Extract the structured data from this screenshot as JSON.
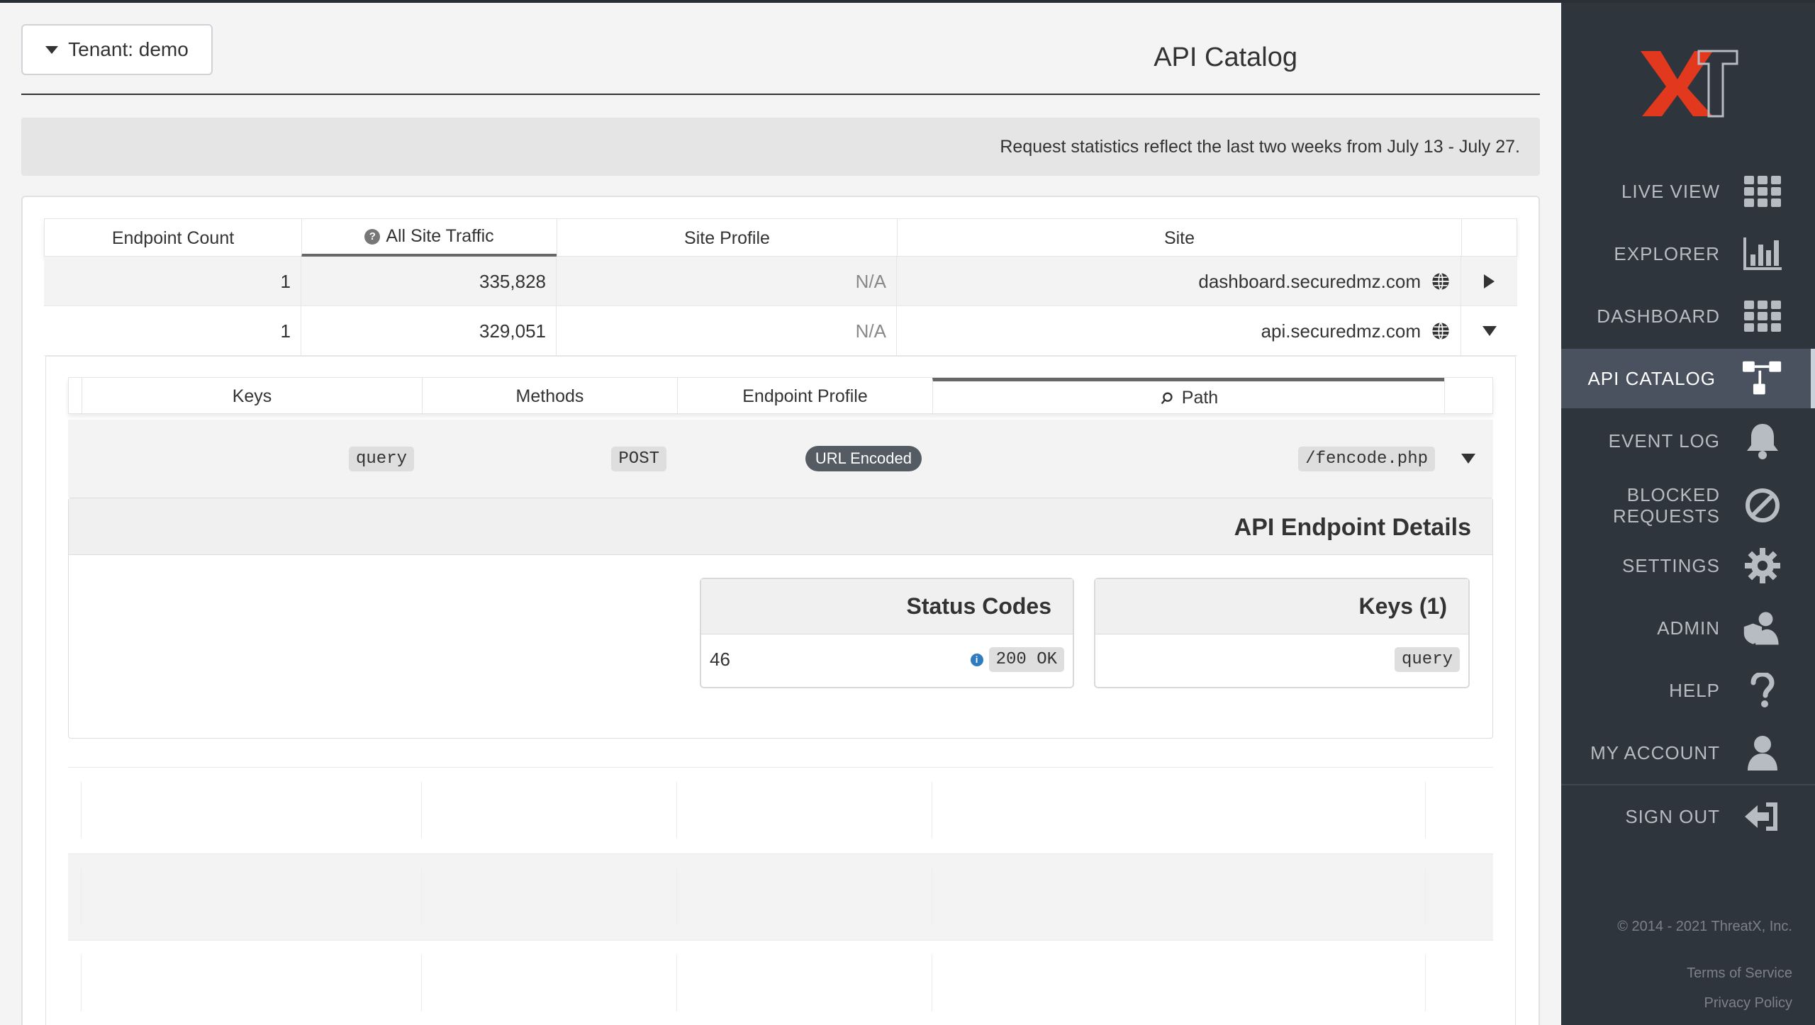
{
  "app": {
    "tenant_button": "Tenant: demo",
    "page_title": "API Catalog",
    "notice": "Request statistics reflect the last two weeks from July 13 - July 27."
  },
  "sidebar": {
    "items": [
      {
        "label": "LIVE VIEW",
        "icon": "grid-icon"
      },
      {
        "label": "EXPLORER",
        "icon": "bar-chart-icon"
      },
      {
        "label": "DASHBOARD",
        "icon": "dashboard-grid-icon"
      },
      {
        "label": "API CATALOG",
        "icon": "api-catalog-icon",
        "active": true
      },
      {
        "label": "EVENT LOG",
        "icon": "bell-icon"
      },
      {
        "label": "BLOCKED\nREQUESTS",
        "icon": "blocked-icon"
      },
      {
        "label": "SETTINGS",
        "icon": "gear-icon"
      },
      {
        "label": "ADMIN",
        "icon": "admin-shield-icon"
      },
      {
        "label": "HELP",
        "icon": "help-question-icon"
      },
      {
        "label": "MY ACCOUNT",
        "icon": "user-icon"
      },
      {
        "label": "SIGN OUT",
        "icon": "sign-out-icon"
      }
    ],
    "footer": {
      "copyright": "© 2014 - 2021 ThreatX, Inc.",
      "terms": "Terms of Service",
      "privacy": "Privacy Policy"
    },
    "accent_color": "#e2381e"
  },
  "sites_table": {
    "columns": [
      "Site",
      "Site Profile",
      "All Site Traffic",
      "Endpoint Count"
    ],
    "rows": [
      {
        "site": "dashboard.securedmz.com",
        "profile": "N/A",
        "traffic": "335,828",
        "endpoints": "1",
        "expanded": false
      },
      {
        "site": "api.securedmz.com",
        "profile": "N/A",
        "traffic": "329,051",
        "endpoints": "1",
        "expanded": true
      }
    ]
  },
  "endpoints_table": {
    "columns": [
      "Path",
      "Endpoint Profile",
      "Methods",
      "Keys"
    ],
    "rows": [
      {
        "path": "/fencode.php",
        "profile": "URL Encoded",
        "methods": "POST",
        "keys": "query"
      }
    ]
  },
  "endpoint_details": {
    "title": "API Endpoint Details",
    "keys_card": {
      "title": "Keys (1)",
      "items": [
        "query"
      ]
    },
    "status_card": {
      "title": "Status Codes",
      "items": [
        {
          "code": "200 OK",
          "count": "46"
        }
      ]
    }
  }
}
